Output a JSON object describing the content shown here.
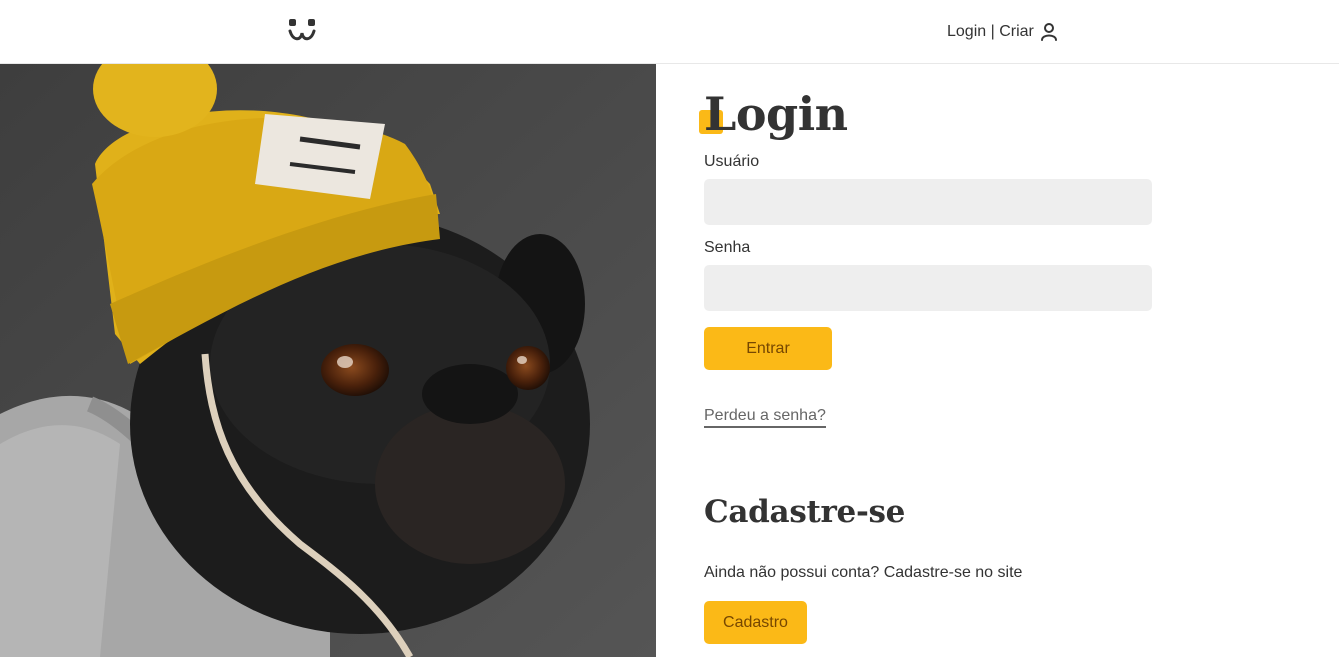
{
  "header": {
    "logo_icon": "dog-face-icon",
    "user_link": "Login | Criar",
    "user_icon": "user-icon"
  },
  "photo": {
    "subject": "pug-in-yellow-beanie-image"
  },
  "login": {
    "title": "Login",
    "username_label": "Usuário",
    "username_value": "",
    "password_label": "Senha",
    "password_value": "",
    "submit_label": "Entrar",
    "lost_password": "Perdeu a senha?"
  },
  "signup": {
    "title": "Cadastre-se",
    "text": "Ainda não possui conta? Cadastre-se no site",
    "button_label": "Cadastro"
  },
  "colors": {
    "accent": "#fbb917",
    "button_text": "#764701",
    "field_bg": "#eeeeee",
    "text": "#333333"
  }
}
